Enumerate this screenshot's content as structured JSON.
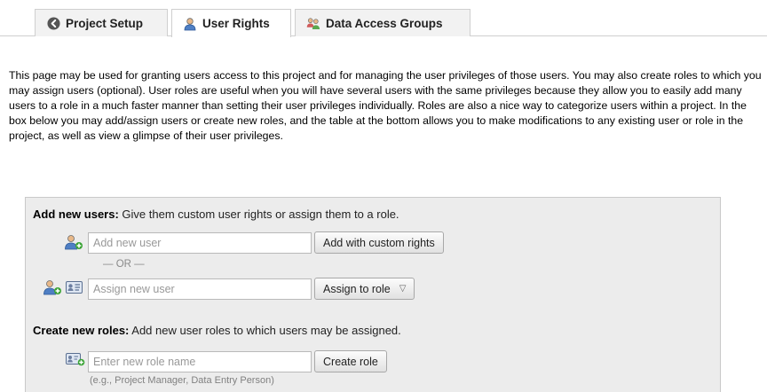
{
  "tabs": [
    {
      "label": "Project Setup",
      "icon": "circle-left-arrow-icon"
    },
    {
      "label": "User Rights",
      "icon": "user-icon",
      "active": true
    },
    {
      "label": "Data Access Groups",
      "icon": "group-icon"
    }
  ],
  "description": "This page may be used for granting users access to this project and for managing the user privileges of those users. You may also create roles to which you may assign users (optional). User roles are useful when you will have several users with the same privileges because they allow you to easily add many users to a role in a much faster manner than setting their user privileges individually. Roles are also a nice way to categorize users within a project. In the box below you may add/assign users or create new roles, and the table at the bottom allows you to make modifications to any existing user or role in the project, as well as view a glimpse of their user privileges.",
  "add_users": {
    "title": "Add new users:",
    "subtitle": "Give them custom user rights or assign them to a role.",
    "new_user_placeholder": "Add new user",
    "custom_rights_button": "Add with custom rights",
    "or_text": "— OR —",
    "assign_placeholder": "Assign new user",
    "assign_role_button": "Assign to role",
    "assign_role_caret": "▽"
  },
  "create_roles": {
    "title": "Create new roles:",
    "subtitle": "Add new user roles to which users may be assigned.",
    "role_placeholder": "Enter new role name",
    "create_button": "Create role",
    "hint": "(e.g., Project Manager, Data Entry Person)"
  },
  "colors": {
    "panel_bg": "#ececec",
    "user_icon_blue": "#4f7fc4",
    "add_green": "#3aa335"
  }
}
